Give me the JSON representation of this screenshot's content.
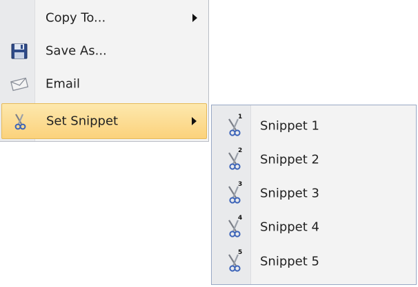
{
  "menu": {
    "items": [
      {
        "label": "Copy To...",
        "icon": "copy-icon",
        "has_submenu": true
      },
      {
        "label": "Save As...",
        "icon": "floppy-disk-icon",
        "has_submenu": false
      },
      {
        "label": "Email",
        "icon": "envelope-icon",
        "has_submenu": false
      },
      {
        "label": "Set Snippet",
        "icon": "scissors-icon",
        "has_submenu": true,
        "highlighted": true
      }
    ]
  },
  "submenu": {
    "items": [
      {
        "label": "Snippet 1",
        "icon": "scissors-icon",
        "badge": "1"
      },
      {
        "label": "Snippet 2",
        "icon": "scissors-icon",
        "badge": "2"
      },
      {
        "label": "Snippet 3",
        "icon": "scissors-icon",
        "badge": "3"
      },
      {
        "label": "Snippet 4",
        "icon": "scissors-icon",
        "badge": "4"
      },
      {
        "label": "Snippet 5",
        "icon": "scissors-icon",
        "badge": "5"
      }
    ]
  },
  "colors": {
    "highlight": "#fbd27c",
    "menu_bg": "#f3f3f3",
    "submenu_border": "#97a7c4"
  }
}
